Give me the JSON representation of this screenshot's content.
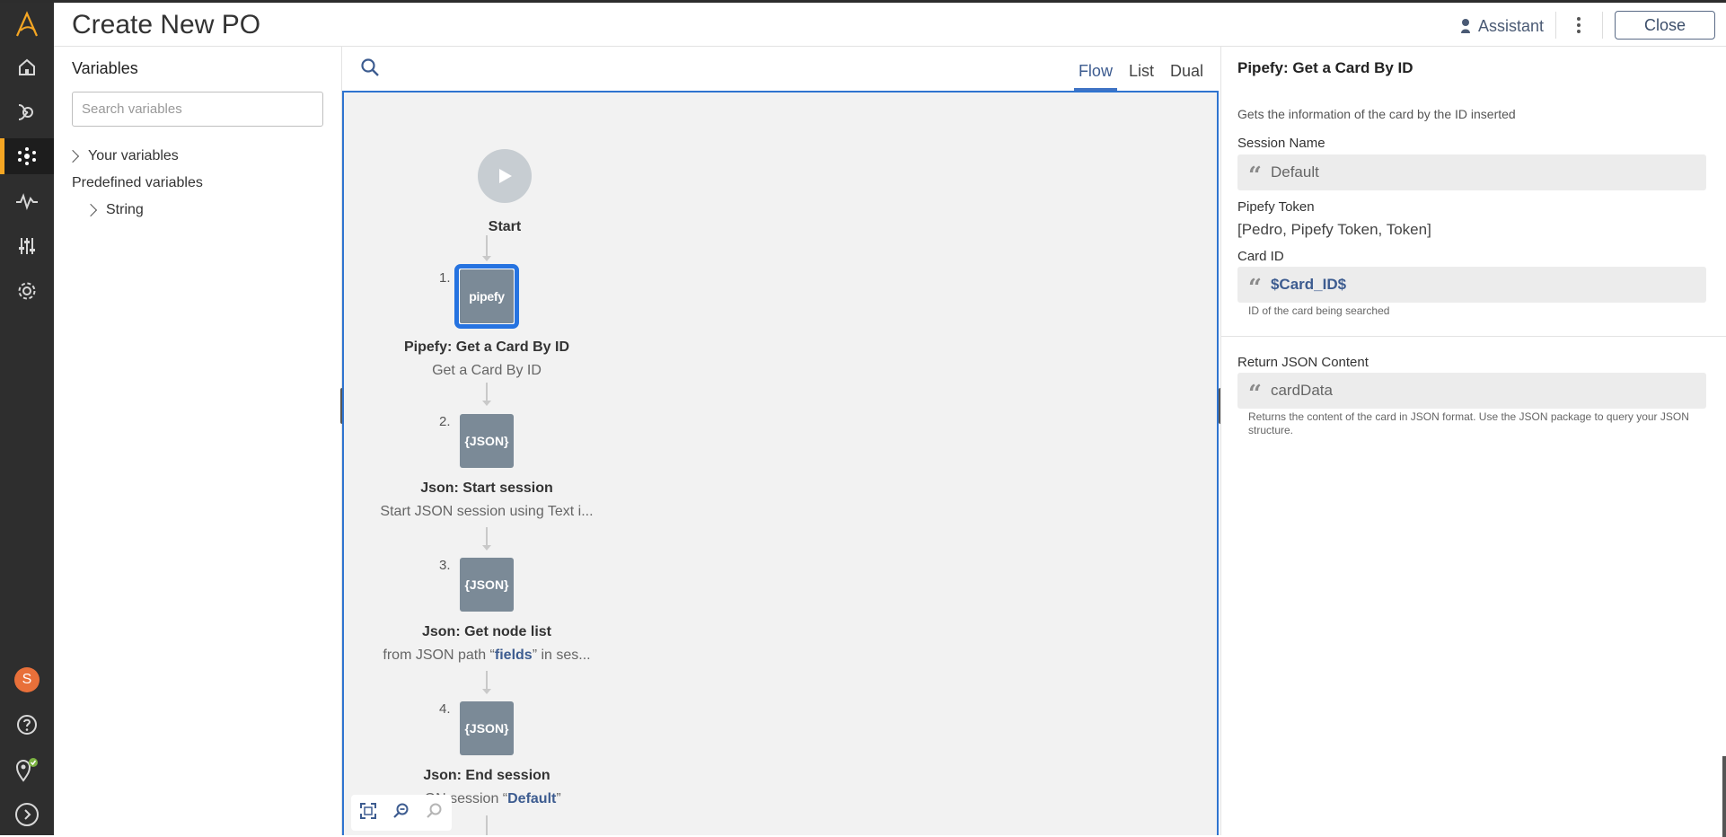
{
  "header": {
    "title": "Create New PO",
    "assistant_label": "Assistant",
    "close_label": "Close"
  },
  "nav": {
    "items": [
      "logo-icon",
      "home-icon",
      "bots-icon",
      "flow-icon",
      "monitor-icon",
      "sliders-icon",
      "settings-icon"
    ],
    "active": "flow-icon",
    "user_initial": "S"
  },
  "variables": {
    "heading": "Variables",
    "search_placeholder": "Search variables",
    "your_variables": "Your variables",
    "predefined": "Predefined variables",
    "string": "String"
  },
  "canvas": {
    "tabs": [
      "Flow",
      "List",
      "Dual"
    ],
    "active_tab": "Flow",
    "start_label": "Start",
    "steps": [
      {
        "num": "1.",
        "icon": "pipefy",
        "title": "Pipefy: Get a Card By ID",
        "subtitle": "Get a Card By ID"
      },
      {
        "num": "2.",
        "icon": "{JSON}",
        "title": "Json: Start session",
        "subtitle": "Start JSON session using Text i..."
      },
      {
        "num": "3.",
        "icon": "{JSON}",
        "title": "Json: Get node list",
        "subtitle_pre": "from JSON path “",
        "subtitle_bold": "fields",
        "subtitle_post": "” in ses..."
      },
      {
        "num": "4.",
        "icon": "{JSON}",
        "title": "Json: End session",
        "subtitle_pre": "...ON session “",
        "subtitle_bold": "Default",
        "subtitle_post": "”"
      }
    ]
  },
  "props": {
    "title": "Pipefy: Get a Card By ID",
    "description": "Gets the information of the card by the ID inserted",
    "session_label": "Session Name",
    "session_value": "Default",
    "token_label": "Pipefy Token",
    "token_value": "[Pedro, Pipefy Token, Token]",
    "cardid_label": "Card ID",
    "cardid_value": "$Card_ID$",
    "cardid_help": "ID of the card being searched",
    "return_label": "Return JSON Content",
    "return_value": "cardData",
    "return_help": "Returns the content of the card in JSON format. Use the JSON package to query your JSON structure."
  },
  "colors": {
    "accent": "#2f74d0",
    "brand": "#f5a623",
    "rail": "#2e2e2e"
  }
}
